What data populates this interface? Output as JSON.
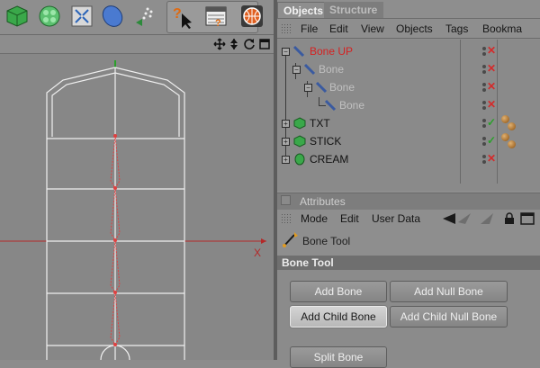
{
  "right_tabs": [
    "Objects",
    "Structure"
  ],
  "object_menu": [
    "File",
    "Edit",
    "View",
    "Objects",
    "Tags",
    "Bookma"
  ],
  "objects": [
    {
      "name": "Bone UP",
      "color": "#d42222"
    },
    {
      "name": "Bone",
      "color": "#c0c0c0"
    },
    {
      "name": "Bone",
      "color": "#c0c0c0"
    },
    {
      "name": "Bone",
      "color": "#c0c0c0"
    },
    {
      "name": "TXT",
      "color": "#111111"
    },
    {
      "name": "STICK",
      "color": "#111111"
    },
    {
      "name": "CREAM",
      "color": "#111111"
    }
  ],
  "attributes": {
    "title": "Attributes",
    "menu": [
      "Mode",
      "Edit",
      "User Data"
    ],
    "tool_name": "Bone Tool",
    "section_title": "Bone Tool",
    "buttons": {
      "add_bone": "Add Bone",
      "add_null_bone": "Add Null Bone",
      "add_child_bone": "Add Child Bone",
      "add_child_null_bone": "Add Child Null Bone",
      "split_bone": "Split Bone"
    }
  },
  "viewport": {
    "axis_label": "X"
  },
  "icons": [
    "cube-icon",
    "subdivision-icon",
    "deformer-icon",
    "generator-icon",
    "particle-icon",
    "help-pointer-icon",
    "render-settings-icon",
    "render-icon",
    "move-view-icon",
    "zoom-view-icon",
    "rotate-view-icon",
    "maximize-view-icon"
  ],
  "colors": {
    "background": "#8c8c8c",
    "active_object": "#d42222",
    "inactive_object": "#c0c0c0",
    "axis_x": "#b42828",
    "axis_y": "#2aa02a",
    "bone": "#e04040"
  }
}
